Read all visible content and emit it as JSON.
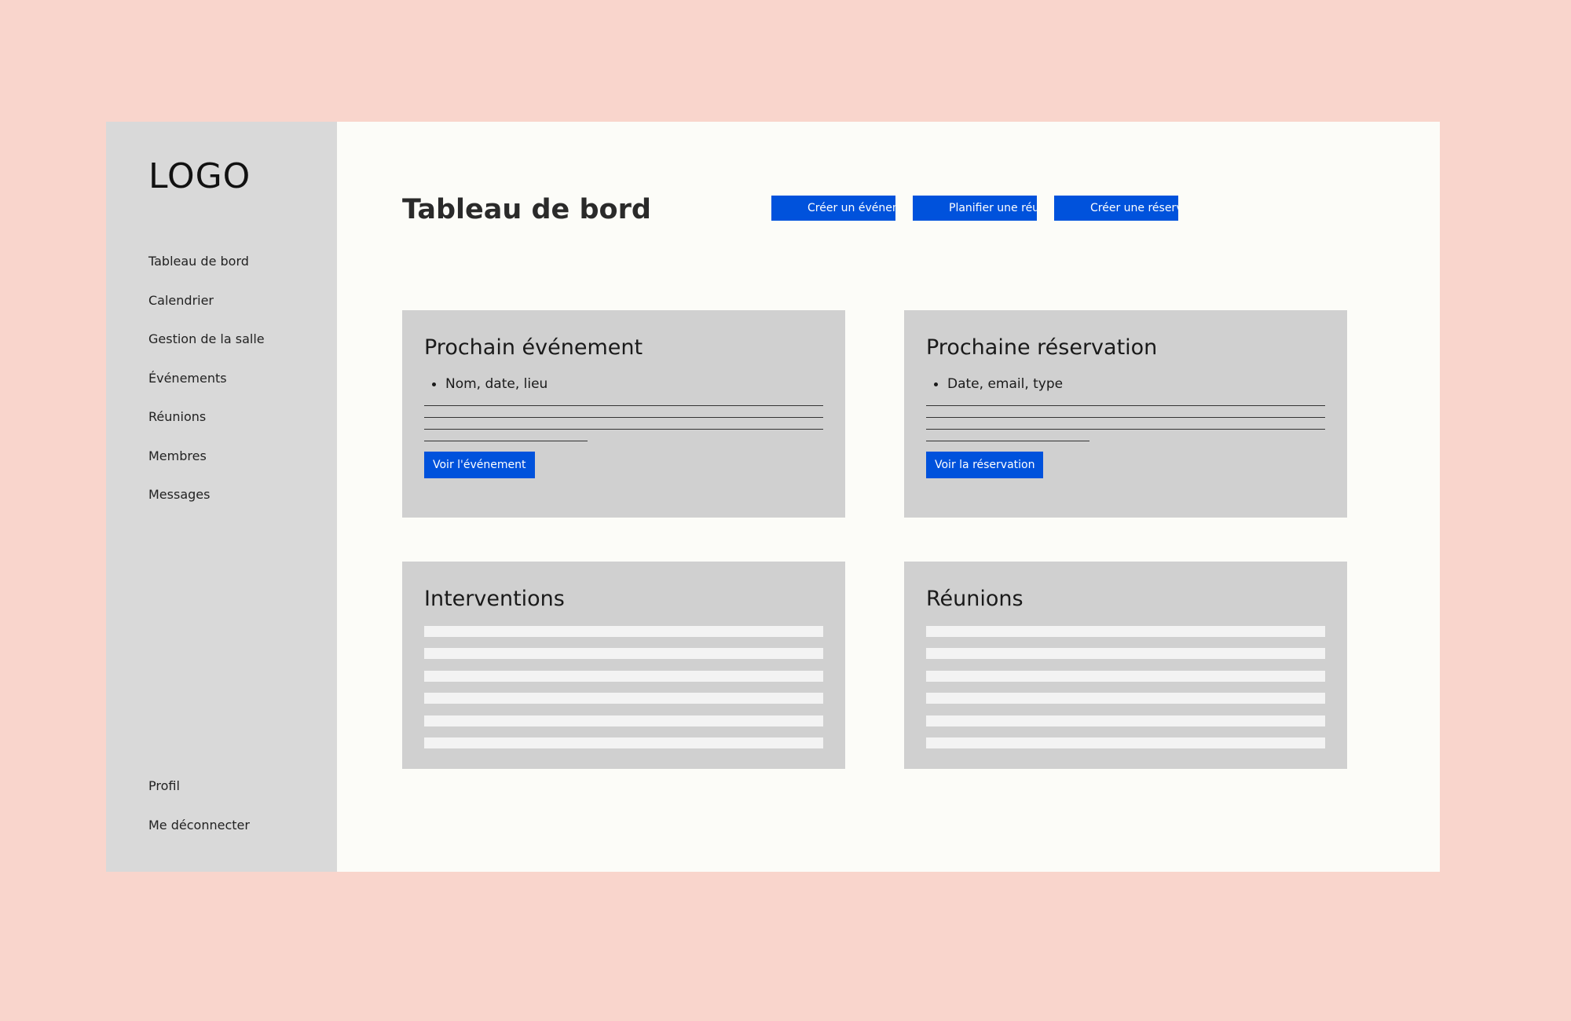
{
  "sidebar": {
    "logo": "LOGO",
    "nav_items": [
      "Tableau de bord",
      "Calendrier",
      "Gestion de la salle",
      "Événements",
      "Réunions",
      "Membres",
      "Messages"
    ],
    "bottom_items": [
      "Profil",
      "Me déconnecter"
    ]
  },
  "header": {
    "title": "Tableau de bord",
    "actions": [
      "Créer un événement",
      "Planifier une réunion",
      "Créer une réservation"
    ]
  },
  "cards": {
    "next_event": {
      "title": "Prochain événement",
      "bullet": "Nom, date, lieu",
      "button": "Voir l'événement"
    },
    "next_booking": {
      "title": "Prochaine réservation",
      "bullet": "Date, email, type",
      "button": "Voir la réservation"
    },
    "interventions": {
      "title": "Interventions"
    },
    "meetings": {
      "title": "Réunions"
    }
  },
  "colors": {
    "background": "#f9d5cc",
    "sidebar": "#d9d9d9",
    "main": "#fcfcf8",
    "card": "#d0d0d0",
    "accent": "#0052dc"
  }
}
